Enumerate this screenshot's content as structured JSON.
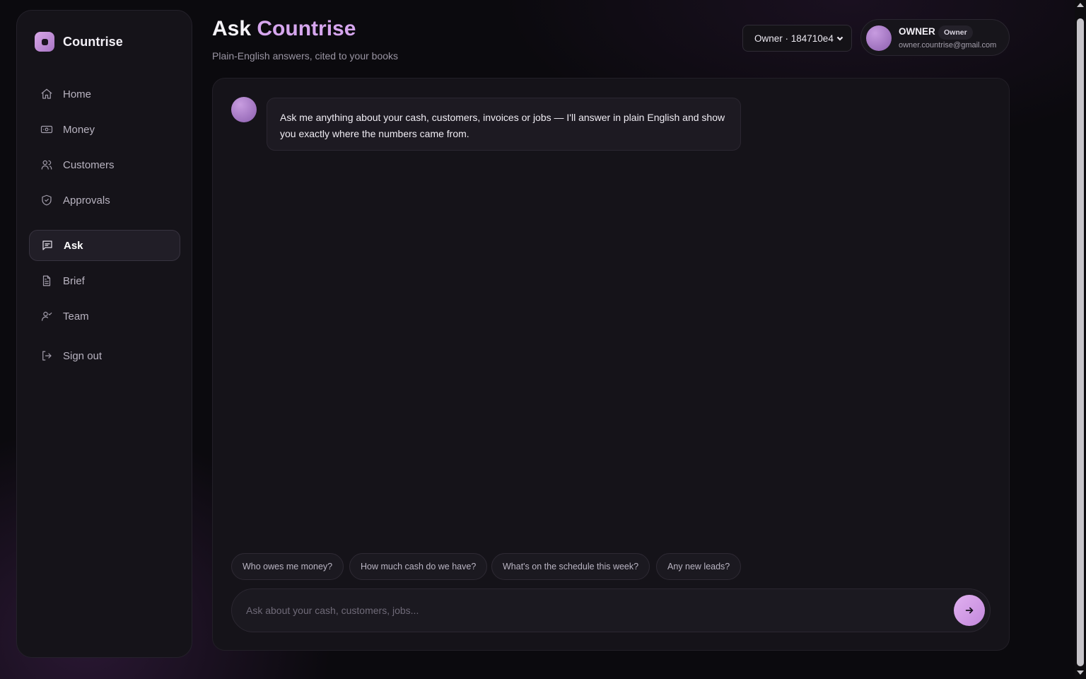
{
  "brand": {
    "name": "Countrise",
    "logo_icon": "countrise-logo-icon"
  },
  "sidebar": {
    "items": [
      {
        "label": "Home",
        "icon": "home-icon",
        "active": false
      },
      {
        "label": "Money",
        "icon": "banknote-icon",
        "active": false
      },
      {
        "label": "Customers",
        "icon": "users-icon",
        "active": false
      },
      {
        "label": "Approvals",
        "icon": "shield-check-icon",
        "active": false
      },
      {
        "label": "Ask",
        "icon": "message-icon",
        "active": true
      },
      {
        "label": "Brief",
        "icon": "file-text-icon",
        "active": false
      },
      {
        "label": "Team",
        "icon": "user-check-icon",
        "active": false
      },
      {
        "label": "Sign out",
        "icon": "log-out-icon",
        "active": false
      }
    ]
  },
  "header": {
    "title_prefix": "Ask",
    "title_accent": "Countrise",
    "subtitle": "Plain-English answers, cited to your books",
    "owner_select": {
      "value": "Owner · 184710e4",
      "icon": "chevron-down-icon"
    },
    "user": {
      "name": "OWNER",
      "role": "Owner",
      "email": "owner.countrise@gmail.com"
    }
  },
  "chat": {
    "messages": [
      {
        "from": "assistant",
        "text": "Ask me anything about your cash, customers, invoices or jobs — I'll answer in plain English and show you exactly where the numbers came from."
      }
    ],
    "suggestions": [
      "Who owes me money?",
      "How much cash do we have?",
      "What's on the schedule this week?",
      "Any new leads?"
    ],
    "composer": {
      "placeholder": "Ask about your cash, customers, jobs...",
      "value": "",
      "send_icon": "arrow-right-icon"
    }
  },
  "colors": {
    "accent": "#d6a6ee",
    "background": "#0b0a0e",
    "panel": "#151319"
  }
}
